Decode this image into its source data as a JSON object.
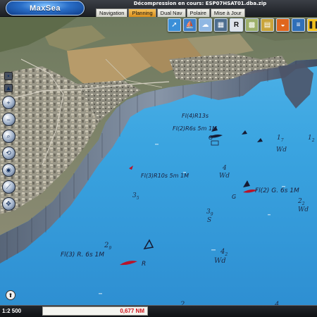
{
  "app": {
    "logo_text": "MaxSea",
    "status_text": "Décompression en cours: ESP07HSAT01.dba.zip"
  },
  "tabs": [
    {
      "label": "Navigation",
      "active": false
    },
    {
      "label": "Planning",
      "active": true
    },
    {
      "label": "Dual Nav",
      "active": false
    },
    {
      "label": "Polaire",
      "active": false
    },
    {
      "label": "Mise à Jour",
      "active": false
    }
  ],
  "toolbar": {
    "buttons": [
      {
        "icon": "route-planning-icon",
        "color": "#3a8fd8"
      },
      {
        "icon": "boat-icon",
        "color": "#3d7fc9"
      },
      {
        "icon": "weather-icon",
        "color": "#8fb7e3"
      },
      {
        "icon": "photo-icon",
        "color": "#4d6e8f"
      },
      {
        "icon": "raster-chart-icon",
        "label": "R",
        "color": "#dfe4ea"
      },
      {
        "icon": "vector-chart-icon",
        "color": "#9db06a"
      },
      {
        "icon": "image-overlay-icon",
        "color": "#c9a43a"
      },
      {
        "icon": "sunset-icon",
        "color": "#e0661d"
      },
      {
        "icon": "layers-icon",
        "color": "#2f6fb8"
      },
      {
        "icon": "pause-icon",
        "color": "#f0c020"
      }
    ]
  },
  "left_toolbar": [
    {
      "icon": "zoom-in-icon"
    },
    {
      "icon": "zoom-out-icon"
    },
    {
      "icon": "magnifier-icon"
    },
    {
      "icon": "rotate-view-icon"
    },
    {
      "icon": "center-boat-icon"
    },
    {
      "icon": "ruler-icon"
    },
    {
      "icon": "pan-icon"
    }
  ],
  "chart": {
    "depths": [
      {
        "text": "1",
        "sub": "7"
      },
      {
        "text": "Wd",
        "sub": ""
      },
      {
        "text": "4",
        "sub": ""
      },
      {
        "text": "Wd",
        "sub": ""
      },
      {
        "text": "3",
        "sub": "5"
      },
      {
        "text": "3",
        "sub": "9"
      },
      {
        "text": "S",
        "sub": ""
      },
      {
        "text": "2",
        "sub": "2"
      },
      {
        "text": "Wd",
        "sub": ""
      },
      {
        "text": "2",
        "sub": "9"
      },
      {
        "text": "4",
        "sub": "2"
      },
      {
        "text": "Wd",
        "sub": ""
      },
      {
        "text": "2",
        "sub": "8"
      },
      {
        "text": "4",
        "sub": "4"
      },
      {
        "text": "1",
        "sub": "2"
      }
    ],
    "light_labels": [
      {
        "text": "Fl(4)R13s"
      },
      {
        "text": "Fl(2)R6s 5m 1M"
      },
      {
        "text": "Fl(3)R10s 5m 1M"
      },
      {
        "text": "Fl(2) G. 6s 1M"
      },
      {
        "text": "Fl(3) R. 6s 1M"
      }
    ],
    "mark_labels": [
      {
        "text": "G"
      },
      {
        "text": "G"
      },
      {
        "text": "R"
      }
    ]
  },
  "status_bar": {
    "scale": "1:2 500",
    "distance": "0,677 NM"
  }
}
